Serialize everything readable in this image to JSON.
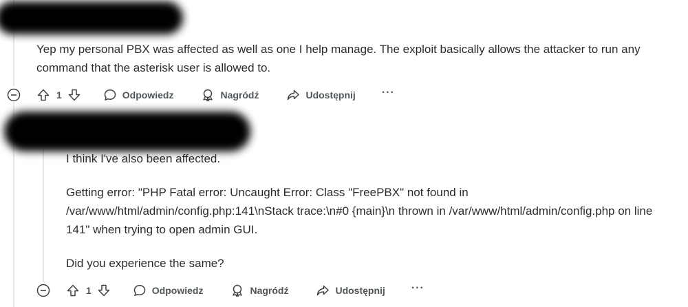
{
  "comments": [
    {
      "paragraphs": [
        "Yep my personal PBX was affected as well as one I help manage. The exploit basically allows the attacker to run any command that the asterisk user is allowed to."
      ],
      "actions": {
        "vote_count": "1",
        "reply": "Odpowiedz",
        "award": "Nagródź",
        "share": "Udostępnij",
        "more": "···"
      }
    },
    {
      "paragraphs": [
        "I think I've also been affected.",
        "Getting error: \"PHP Fatal error: Uncaught Error: Class \"FreePBX\" not found in /var/www/html/admin/config.php:141\\nStack trace:\\n#0 {main}\\n thrown in /var/www/html/admin/config.php on line 141\" when trying to open admin GUI.",
        "Did you experience the same?"
      ],
      "actions": {
        "vote_count": "1",
        "reply": "Odpowiedz",
        "award": "Nagródź",
        "share": "Udostępnij",
        "more": "···"
      }
    }
  ]
}
